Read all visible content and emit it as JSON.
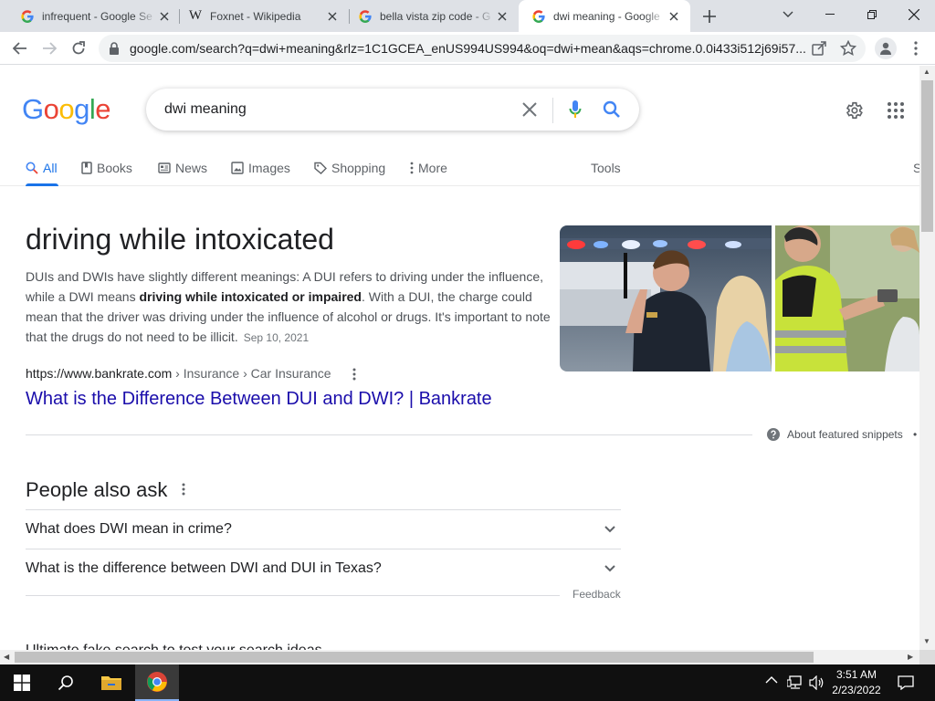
{
  "browser": {
    "tabs": [
      {
        "title": "infrequent - Google Se",
        "favicon": "google-g-icon",
        "active": false
      },
      {
        "title": "Foxnet - Wikipedia",
        "favicon": "wikipedia-w-icon",
        "active": false
      },
      {
        "title": "bella vista zip code - G",
        "favicon": "google-g-icon",
        "active": false
      },
      {
        "title": "dwi meaning - Google",
        "favicon": "google-g-icon",
        "active": true
      }
    ],
    "url": "google.com/search?q=dwi+meaning&rlz=1C1GCEA_enUS994US994&oq=dwi+mean&aqs=chrome.0.0i433i512j69i57..."
  },
  "search": {
    "logo": "Google",
    "query": "dwi meaning",
    "tabs": [
      {
        "label": "All",
        "icon": "search-icon",
        "active": true
      },
      {
        "label": "Books",
        "icon": "book-icon",
        "active": false
      },
      {
        "label": "News",
        "icon": "news-icon",
        "active": false
      },
      {
        "label": "Images",
        "icon": "image-icon",
        "active": false
      },
      {
        "label": "Shopping",
        "icon": "tag-icon",
        "active": false
      },
      {
        "label": "More",
        "icon": "more-vert-icon",
        "active": false
      }
    ],
    "tools_label": "Tools",
    "safesearch_partial": "S"
  },
  "featured_snippet": {
    "title": "driving while intoxicated",
    "text_before": "DUIs and DWIs have slightly different meanings: A DUI refers to driving under the influence, while a DWI means ",
    "text_bold": "driving while intoxicated or impaired",
    "text_after": ". With a DUI, the charge could mean that the driver was driving under the influence of alcohol or drugs. It's important to note that the drugs do not need to be illicit.",
    "date": "Sep 10, 2021",
    "cite_domain": "https://www.bankrate.com",
    "cite_path": " › Insurance › Car Insurance",
    "link_title": "What is the Difference Between DUI and DWI? | Bankrate",
    "about_label": "About featured snippets",
    "about_more": "•"
  },
  "people_also_ask": {
    "title": "People also ask",
    "questions": [
      "What does DWI mean in crime?",
      "What is the difference between DWI and DUI in Texas?"
    ],
    "feedback": "Feedback"
  },
  "cutoff_text": "Ultimate fake search to test your search ideas",
  "taskbar": {
    "time": "3:51 AM",
    "date": "2/23/2022"
  },
  "colors": {
    "link": "#1a0dab",
    "accent": "#1a73e8",
    "taskbar": "#101010",
    "tabstrip": "#dee1e6"
  }
}
